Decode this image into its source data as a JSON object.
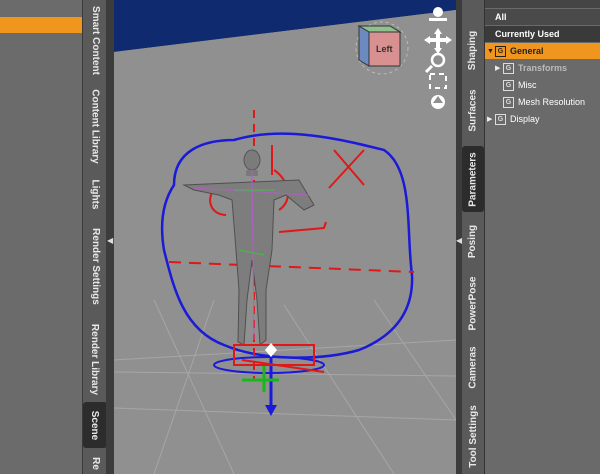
{
  "left_panel_tabs": [
    "Smart Content",
    "Content Library",
    "Lights",
    "Render Settings",
    "Render Library",
    "Scene",
    "Re"
  ],
  "right_panel_tabs": [
    "Shaping",
    "Surfaces",
    "Parameters",
    "Posing",
    "PowerPose",
    "Cameras",
    "Tool Settings"
  ],
  "viewport": {
    "view_cube_label": "Left"
  },
  "parameters": {
    "all_label": "All",
    "currently_used_label": "Currently Used",
    "tree": [
      {
        "label": "General",
        "group": "G",
        "selected": true,
        "expanded": true
      },
      {
        "label": "Transforms",
        "group": "G",
        "child": true
      },
      {
        "label": "Misc",
        "group": "G",
        "child": true
      },
      {
        "label": "Mesh Resolution",
        "group": "G",
        "child": true
      },
      {
        "label": "Display",
        "group": "G"
      }
    ]
  },
  "colors": {
    "accent_orange": "#f0961e",
    "annotation_blue": "#1a1ad8",
    "annotation_red": "#e01818"
  }
}
